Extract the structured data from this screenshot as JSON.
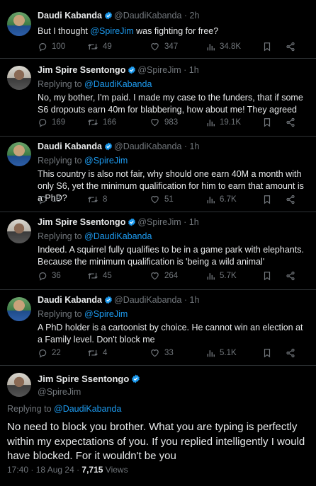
{
  "tweets": [
    {
      "name": "Daudi Kabanda",
      "handle": "@DaudiKabanda",
      "time": "2h",
      "replying_prefix": "",
      "replying_to": "",
      "text_pre": "But I thought ",
      "text_mention": "@SpireJim",
      "text_post": " was fighting for free?",
      "stats": {
        "replies": "100",
        "retweets": "49",
        "likes": "347",
        "views": "34.8K"
      }
    },
    {
      "name": "Jim Spire Ssentongo",
      "handle": "@SpireJim",
      "time": "1h",
      "replying_prefix": "Replying to ",
      "replying_to": "@DaudiKabanda",
      "text_pre": "No, my bother, I'm paid. I made my case to the funders, that if some S6 dropouts earn 40m for blabbering, how about me! They agreed",
      "text_mention": "",
      "text_post": "",
      "stats": {
        "replies": "169",
        "retweets": "166",
        "likes": "983",
        "views": "19.1K"
      }
    },
    {
      "name": "Daudi Kabanda",
      "handle": "@DaudiKabanda",
      "time": "1h",
      "replying_prefix": "Replying to ",
      "replying_to": "@SpireJim",
      "text_pre": "This country is also not fair, why should one earn 40M a month with only S6, yet the minimum qualification for him to earn that amount is a PhD?",
      "text_mention": "",
      "text_post": "",
      "stats": {
        "replies": "18",
        "retweets": "8",
        "likes": "51",
        "views": "6.7K"
      }
    },
    {
      "name": "Jim Spire Ssentongo",
      "handle": "@SpireJim",
      "time": "1h",
      "replying_prefix": "Replying to ",
      "replying_to": "@DaudiKabanda",
      "text_pre": "Indeed. A squirrel fully qualifies to be in a game park with elephants. Because the minimum qualification is 'being a wild animal'",
      "text_mention": "",
      "text_post": "",
      "stats": {
        "replies": "36",
        "retweets": "45",
        "likes": "264",
        "views": "5.7K"
      }
    },
    {
      "name": "Daudi Kabanda",
      "handle": "@DaudiKabanda",
      "time": "1h",
      "replying_prefix": "Replying to ",
      "replying_to": "@SpireJim",
      "text_pre": "A PhD holder is a cartoonist by choice. He cannot win an election at a Family level. Don't block me",
      "text_mention": "",
      "text_post": "",
      "stats": {
        "replies": "22",
        "retweets": "4",
        "likes": "33",
        "views": "5.1K"
      }
    }
  ],
  "main": {
    "name": "Jim Spire Ssentongo",
    "handle": "@SpireJim",
    "replying_prefix": "Replying to ",
    "replying_to": "@DaudiKabanda",
    "text": "No need to block you brother. What you are typing is perfectly within my expectations of you. If you replied intelligently I would have blocked. For it wouldn't be you",
    "time": "17:40 · 18 Aug 24 · ",
    "views_count": "7,715",
    "views_label": " Views"
  },
  "separator": " · ",
  "colors": {
    "background": "#000000",
    "accent": "#1d9bf0",
    "muted": "#71767b",
    "text": "#e7e9ea"
  },
  "icons": [
    "reply-icon",
    "retweet-icon",
    "like-icon",
    "views-icon",
    "bookmark-icon",
    "share-icon",
    "verified-icon"
  ]
}
